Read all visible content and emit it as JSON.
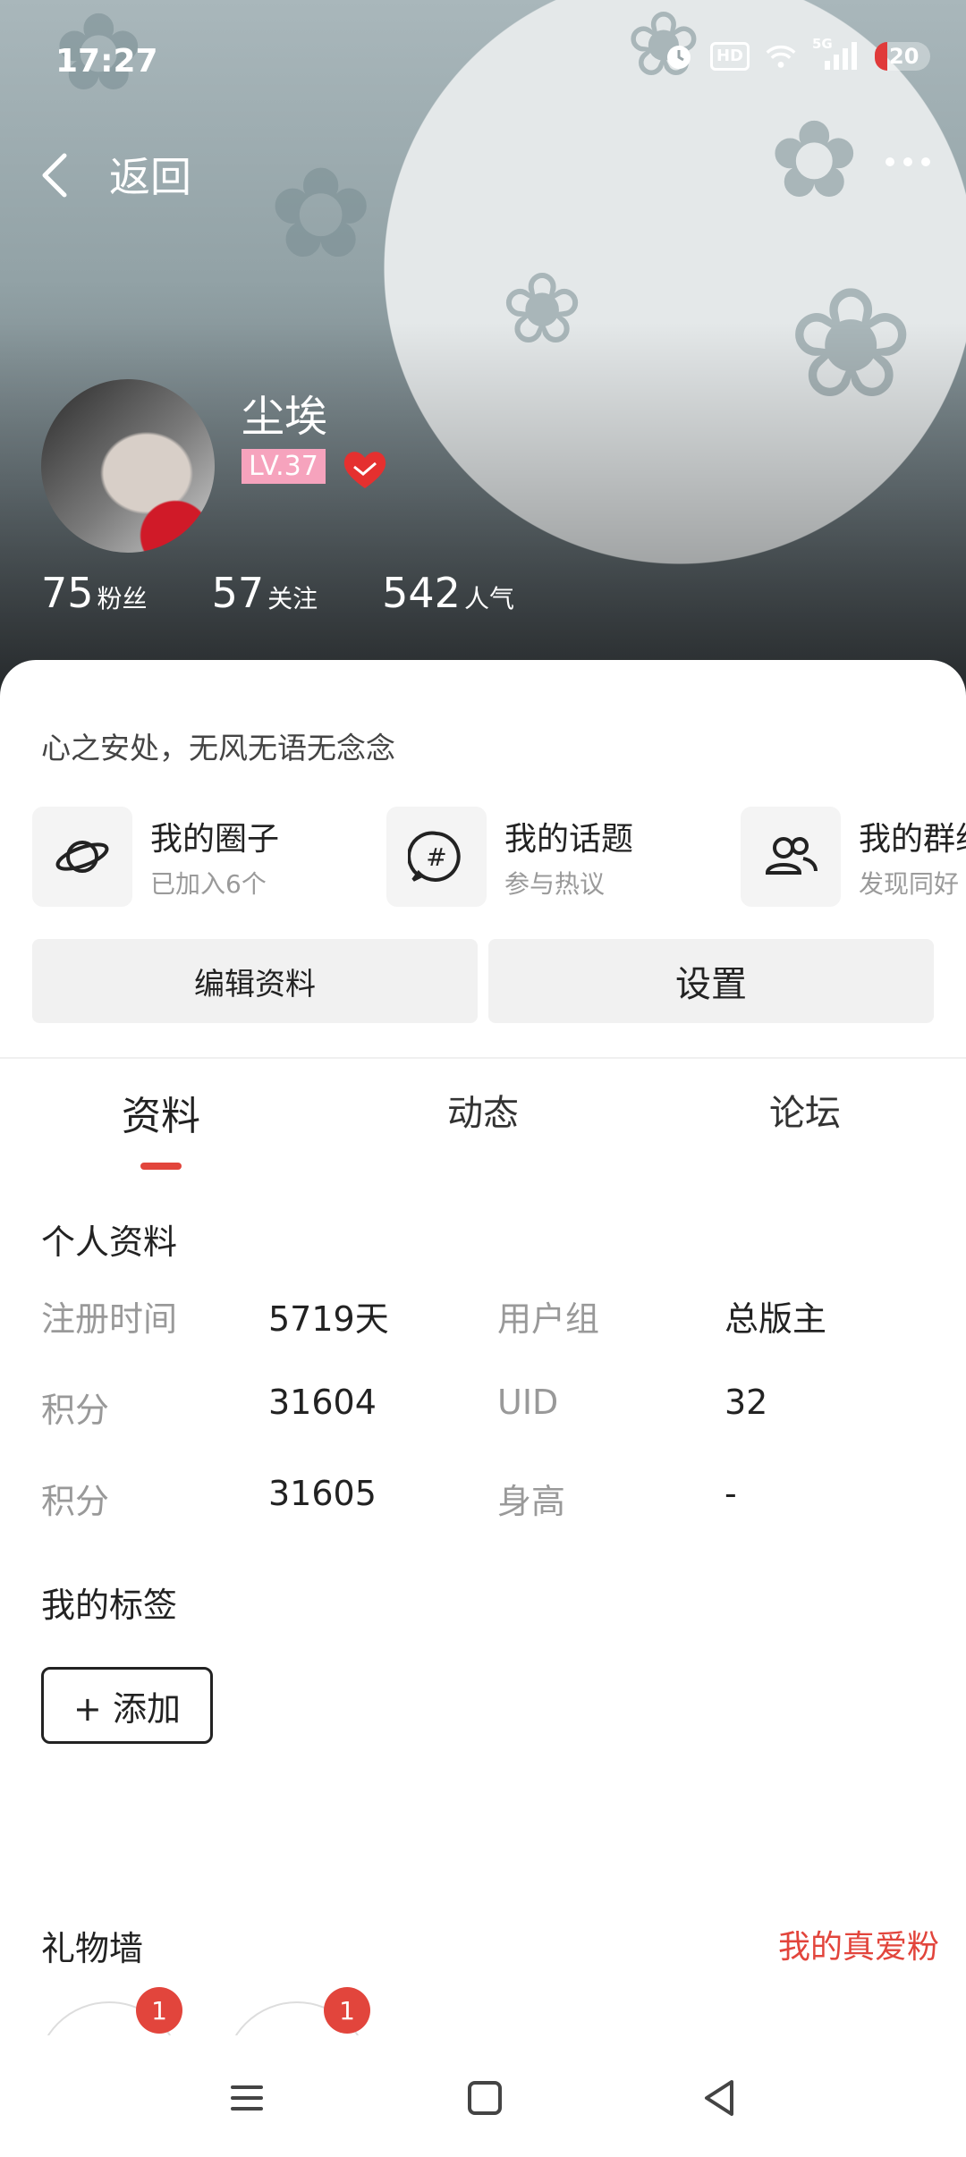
{
  "status_bar": {
    "time": "17:27",
    "battery": "20",
    "hd_label": "HD",
    "net_label": "5G"
  },
  "header": {
    "back_label": "返回"
  },
  "profile": {
    "name": "尘埃",
    "level": "LV.37",
    "stats": [
      {
        "value": "75",
        "label": "粉丝"
      },
      {
        "value": "57",
        "label": "关注"
      },
      {
        "value": "542",
        "label": "人气"
      }
    ],
    "bio": "心之安处，无风无语无念念"
  },
  "shortcuts": [
    {
      "title": "我的圈子",
      "subtitle": "已加入6个",
      "icon": "planet-icon"
    },
    {
      "title": "我的话题",
      "subtitle": "参与热议",
      "icon": "hashtag-bubble-icon"
    },
    {
      "title": "我的群组",
      "subtitle": "发现同好",
      "icon": "group-icon"
    }
  ],
  "actions": {
    "edit": "编辑资料",
    "settings": "设置"
  },
  "tabs": [
    {
      "label": "资料"
    },
    {
      "label": "动态"
    },
    {
      "label": "论坛"
    }
  ],
  "personal_info": {
    "title": "个人资料",
    "rows": [
      {
        "k1": "注册时间",
        "v1": "5719天",
        "k2": "用户组",
        "v2": "总版主"
      },
      {
        "k1": "积分",
        "v1": "31604",
        "k2": "UID",
        "v2": "32"
      },
      {
        "k1": "积分",
        "v1": "31605",
        "k2": "身高",
        "v2": "-"
      }
    ]
  },
  "tags": {
    "title": "我的标签",
    "add_label": "+ 添加"
  },
  "gift_wall": {
    "title": "礼物墙",
    "link": "我的真爱粉",
    "items": [
      {
        "count": "1"
      },
      {
        "count": "1"
      }
    ]
  },
  "colors": {
    "accent": "#e2453c",
    "level_badge": "#f6a3bd"
  }
}
